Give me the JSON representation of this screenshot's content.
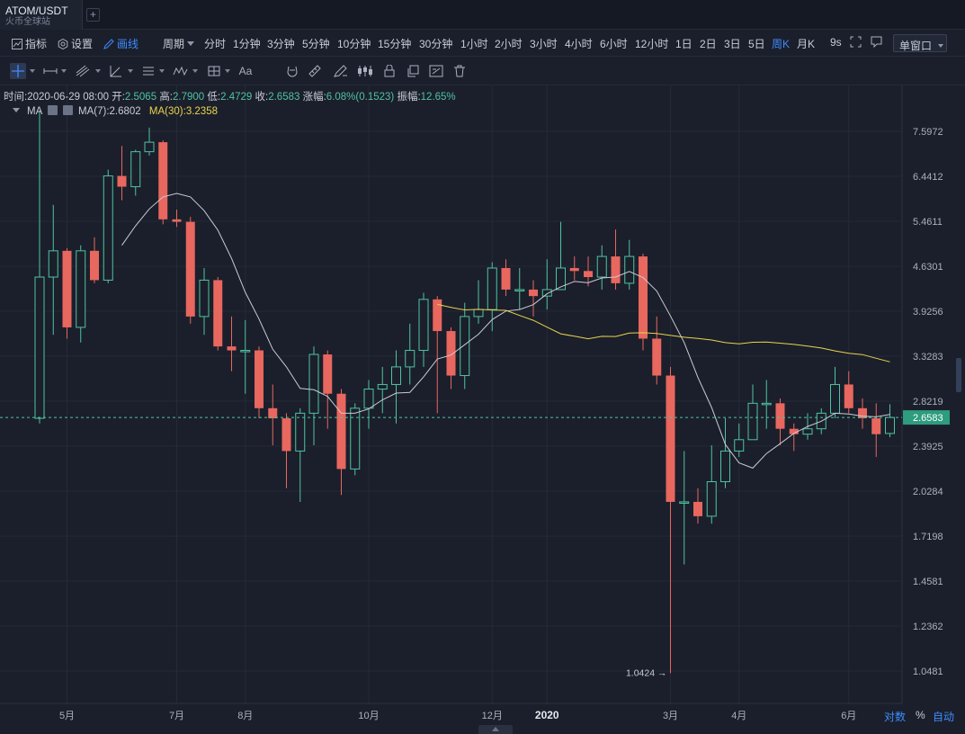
{
  "tab": {
    "symbol": "ATOM/USDT",
    "exchange": "火币全球站",
    "add_label": "+"
  },
  "toolbar": {
    "indicators": "指标",
    "settings": "设置",
    "drawing": "画线",
    "period": "周期",
    "periods": [
      "分时",
      "1分钟",
      "3分钟",
      "5分钟",
      "10分钟",
      "15分钟",
      "30分钟",
      "1小时",
      "2小时",
      "3小时",
      "4小时",
      "6小时",
      "12小时",
      "1日",
      "2日",
      "3日",
      "5日",
      "周K",
      "月K"
    ],
    "active_period": "周K",
    "refresh": "9s",
    "window_mode": "单窗口"
  },
  "draw_tools": {
    "text_tool": "Aa"
  },
  "ohlc": {
    "time_label": "时间:",
    "time": "2020-06-29 08:00",
    "open_label": "开:",
    "open": "2.5065",
    "high_label": "高:",
    "high": "2.7900",
    "low_label": "低:",
    "low": "2.4729",
    "close_label": "收:",
    "close": "2.6583",
    "change_label": "涨幅:",
    "change": "6.08%(0.1523)",
    "amplitude_label": "振幅:",
    "amplitude": "12.65%"
  },
  "ma": {
    "label": "MA",
    "ma7": "MA(7):2.6802",
    "ma30": "MA(30):3.2358"
  },
  "bottom_controls": {
    "log": "对数",
    "percent": "%",
    "auto": "自动"
  },
  "colors": {
    "up": "#4fc3a1",
    "down": "#e8675f",
    "ma7": "#c9ccd4",
    "ma30": "#e8d44d",
    "accent": "#3d8cff"
  },
  "chart_data": {
    "type": "candlestick",
    "price_ticks": [
      "7.5972",
      "6.4412",
      "5.4611",
      "4.6301",
      "3.9256",
      "3.3283",
      "2.8219",
      "2.3925",
      "2.0284",
      "1.7198",
      "1.4581",
      "1.2362",
      "1.0481"
    ],
    "current_price": "2.6583",
    "low_marker": "1.0424",
    "x_labels": [
      "5月",
      "7月",
      "8月",
      "10月",
      "12月",
      "2020",
      "3月",
      "4月",
      "6月"
    ],
    "candles": [
      [
        2.65,
        4.45,
        8.2,
        2.6
      ],
      [
        4.45,
        4.9,
        5.8,
        3.6
      ],
      [
        4.9,
        3.7,
        4.95,
        3.55
      ],
      [
        3.7,
        4.9,
        5.0,
        3.5
      ],
      [
        4.9,
        4.4,
        5.15,
        4.35
      ],
      [
        4.4,
        6.45,
        6.6,
        4.35
      ],
      [
        6.45,
        6.2,
        7.2,
        5.9
      ],
      [
        6.2,
        7.05,
        7.1,
        6.0
      ],
      [
        7.05,
        7.3,
        7.7,
        6.95
      ],
      [
        7.3,
        5.5,
        7.35,
        5.4
      ],
      [
        5.5,
        5.45,
        5.7,
        5.35
      ],
      [
        5.45,
        3.85,
        5.55,
        3.75
      ],
      [
        3.85,
        4.4,
        4.6,
        3.6
      ],
      [
        4.4,
        3.45,
        4.45,
        3.4
      ],
      [
        3.45,
        3.4,
        3.85,
        3.15
      ],
      [
        3.4,
        3.4,
        3.8,
        2.9
      ],
      [
        3.4,
        2.75,
        3.45,
        2.65
      ],
      [
        2.75,
        2.65,
        3.0,
        2.4
      ],
      [
        2.65,
        2.35,
        2.7,
        2.05
      ],
      [
        2.35,
        2.7,
        2.75,
        1.95
      ],
      [
        2.7,
        3.35,
        3.45,
        2.4
      ],
      [
        3.35,
        2.9,
        3.4,
        2.55
      ],
      [
        2.9,
        2.2,
        2.95,
        2.0
      ],
      [
        2.2,
        2.75,
        2.8,
        2.15
      ],
      [
        2.75,
        2.95,
        3.05,
        2.55
      ],
      [
        2.95,
        3.0,
        3.2,
        2.7
      ],
      [
        3.0,
        3.2,
        3.4,
        2.6
      ],
      [
        3.2,
        3.4,
        3.75,
        3.0
      ],
      [
        3.4,
        4.1,
        4.2,
        3.2
      ],
      [
        4.1,
        3.65,
        4.15,
        2.7
      ],
      [
        3.65,
        3.1,
        3.7,
        2.95
      ],
      [
        3.1,
        3.85,
        4.05,
        2.95
      ],
      [
        3.85,
        3.95,
        4.4,
        3.75
      ],
      [
        3.95,
        4.6,
        4.7,
        3.65
      ],
      [
        4.6,
        4.25,
        4.75,
        4.15
      ],
      [
        4.25,
        4.25,
        4.6,
        3.95
      ],
      [
        4.25,
        4.15,
        4.4,
        3.85
      ],
      [
        4.15,
        4.25,
        4.75,
        3.95
      ],
      [
        4.25,
        4.6,
        5.45,
        4.25
      ],
      [
        4.6,
        4.55,
        4.8,
        4.4
      ],
      [
        4.55,
        4.45,
        4.8,
        4.3
      ],
      [
        4.45,
        4.8,
        5.0,
        4.25
      ],
      [
        4.8,
        4.35,
        5.3,
        4.25
      ],
      [
        4.35,
        4.8,
        5.1,
        4.25
      ],
      [
        4.8,
        3.55,
        4.85,
        3.4
      ],
      [
        3.55,
        3.1,
        3.85,
        3.0
      ],
      [
        3.1,
        1.95,
        3.2,
        1.04
      ],
      [
        1.95,
        1.95,
        2.35,
        1.55
      ],
      [
        1.95,
        1.85,
        2.05,
        1.8
      ],
      [
        1.85,
        2.1,
        2.4,
        1.8
      ],
      [
        2.1,
        2.35,
        2.65,
        2.05
      ],
      [
        2.35,
        2.45,
        2.6,
        2.3
      ],
      [
        2.45,
        2.8,
        3.0,
        2.45
      ],
      [
        2.8,
        2.8,
        3.05,
        2.55
      ],
      [
        2.8,
        2.55,
        2.85,
        2.4
      ],
      [
        2.55,
        2.5,
        2.6,
        2.35
      ],
      [
        2.5,
        2.55,
        2.7,
        2.45
      ],
      [
        2.55,
        2.7,
        2.75,
        2.5
      ],
      [
        2.7,
        3.0,
        3.2,
        2.65
      ],
      [
        3.0,
        2.75,
        3.15,
        2.7
      ],
      [
        2.75,
        2.65,
        2.85,
        2.55
      ],
      [
        2.65,
        2.5,
        2.8,
        2.3
      ],
      [
        2.5065,
        2.6583,
        2.79,
        2.4729
      ]
    ],
    "ma7_start": 6,
    "ma30_start": 29
  }
}
